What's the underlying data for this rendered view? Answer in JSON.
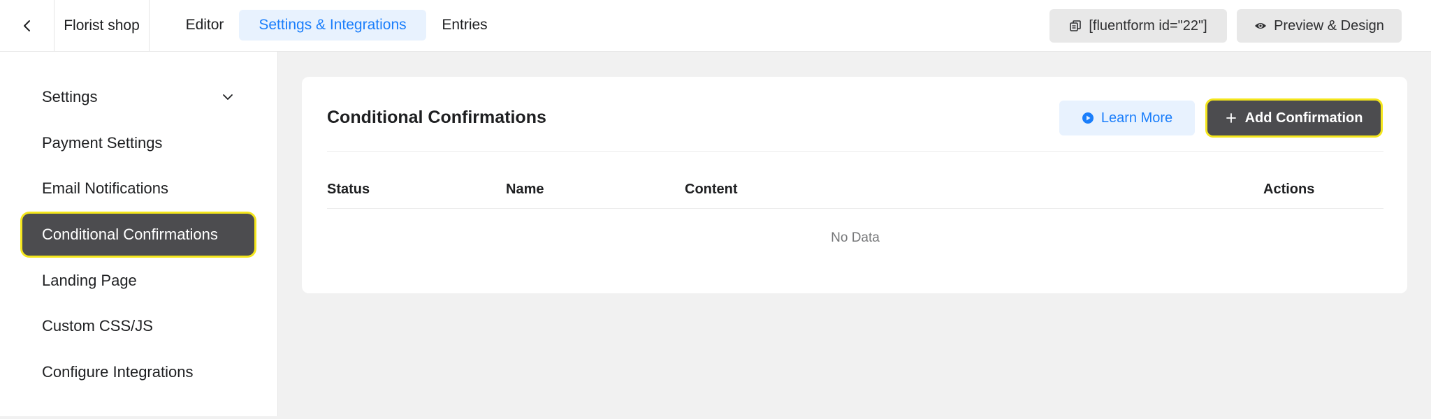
{
  "header": {
    "back_icon": "chevron-left-icon",
    "form_name": "Florist shop",
    "tabs": [
      {
        "label": "Editor",
        "active": false
      },
      {
        "label": "Settings & Integrations",
        "active": true
      },
      {
        "label": "Entries",
        "active": false
      }
    ],
    "shortcode_label": "[fluentform id=\"22\"]",
    "preview_label": "Preview & Design"
  },
  "sidebar": {
    "items": [
      {
        "label": "Settings",
        "active": false,
        "expandable": true
      },
      {
        "label": "Payment Settings",
        "active": false
      },
      {
        "label": "Email Notifications",
        "active": false
      },
      {
        "label": "Conditional Confirmations",
        "active": true
      },
      {
        "label": "Landing Page",
        "active": false
      },
      {
        "label": "Custom CSS/JS",
        "active": false
      },
      {
        "label": "Configure Integrations",
        "active": false
      }
    ]
  },
  "main": {
    "title": "Conditional Confirmations",
    "learn_more_label": "Learn More",
    "add_label": "Add Confirmation",
    "table": {
      "columns": [
        "Status",
        "Name",
        "Content",
        "Actions"
      ],
      "empty_text": "No Data"
    }
  },
  "colors": {
    "accent": "#1a7efb",
    "highlight": "#f4e61c",
    "dark_button": "#4c4c4f"
  }
}
